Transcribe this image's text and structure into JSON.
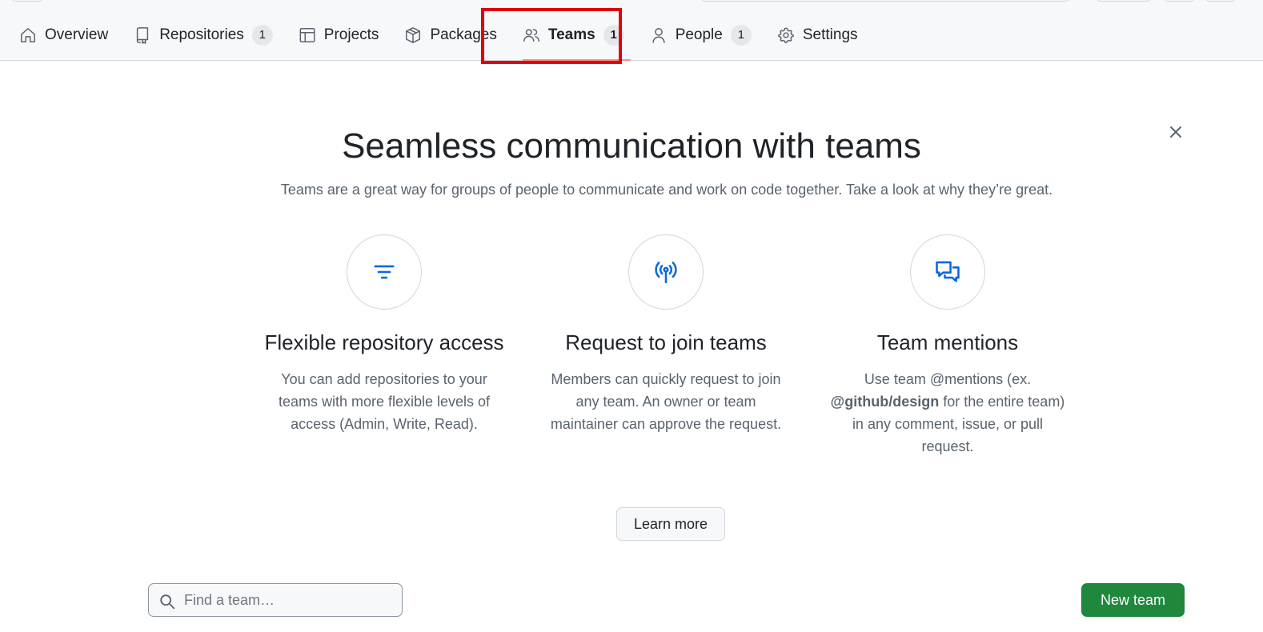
{
  "nav": {
    "items": [
      {
        "label": "Overview",
        "icon": "home-icon",
        "count": null
      },
      {
        "label": "Repositories",
        "icon": "repo-icon",
        "count": "1"
      },
      {
        "label": "Projects",
        "icon": "table-icon",
        "count": null
      },
      {
        "label": "Packages",
        "icon": "package-icon",
        "count": null
      },
      {
        "label": "Teams",
        "icon": "people-icon",
        "count": "1",
        "active": true
      },
      {
        "label": "People",
        "icon": "person-icon",
        "count": "1"
      },
      {
        "label": "Settings",
        "icon": "gear-icon",
        "count": null
      }
    ],
    "highlight_color": "#e0000e"
  },
  "hero": {
    "title": "Seamless communication with teams",
    "subtitle": "Teams are a great way for groups of people to communicate and work on code together. Take a look at why they’re great."
  },
  "features": [
    {
      "icon": "filter-icon",
      "title": "Flexible repository access",
      "text": "You can add repositories to your teams with more flexible levels of access (Admin, Write, Read)."
    },
    {
      "icon": "broadcast-icon",
      "title": "Request to join teams",
      "text": "Members can quickly request to join any team. An owner or team maintainer can approve the request."
    },
    {
      "icon": "comment-discussion-icon",
      "title": "Team mentions",
      "text_before": "Use team @mentions (ex.",
      "text_bold": "@github/design",
      "text_after": "for the entire team) in any comment, issue, or pull request."
    }
  ],
  "learn_more_label": "Learn more",
  "search": {
    "placeholder": "Find a team…"
  },
  "new_team_label": "New team",
  "colors": {
    "accent": "#0969da",
    "primary_button": "#1f883d",
    "active_underline": "#fd8c73"
  }
}
